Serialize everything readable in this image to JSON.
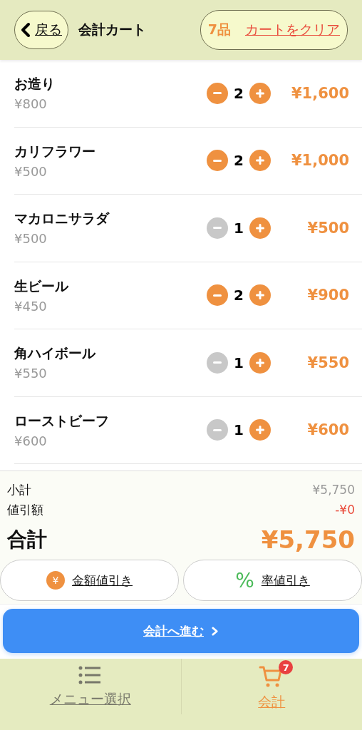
{
  "header": {
    "back_label": "戻る",
    "title": "会計カート",
    "count": "7品",
    "clear_label": "カートをクリア"
  },
  "items": [
    {
      "name": "お造り",
      "unit_price": "¥800",
      "quantity": "2",
      "minus_disabled": false,
      "total": "¥1,600"
    },
    {
      "name": "カリフラワー",
      "unit_price": "¥500",
      "quantity": "2",
      "minus_disabled": false,
      "total": "¥1,000"
    },
    {
      "name": "マカロニサラダ",
      "unit_price": "¥500",
      "quantity": "1",
      "minus_disabled": true,
      "total": "¥500"
    },
    {
      "name": "生ビール",
      "unit_price": "¥450",
      "quantity": "2",
      "minus_disabled": false,
      "total": "¥900"
    },
    {
      "name": "角ハイボール",
      "unit_price": "¥550",
      "quantity": "1",
      "minus_disabled": true,
      "total": "¥550"
    },
    {
      "name": "ローストビーフ",
      "unit_price": "¥600",
      "quantity": "1",
      "minus_disabled": true,
      "total": "¥600"
    }
  ],
  "summary": {
    "subtotal_label": "小計",
    "subtotal": "¥5,750",
    "discount_label": "値引額",
    "discount": "-¥0",
    "total_label": "合計",
    "total": "¥5,750"
  },
  "discount_buttons": [
    {
      "kind": "amount",
      "icon": "¥",
      "label": "金額値引き"
    },
    {
      "kind": "rate",
      "icon": "%",
      "label": "率値引き"
    }
  ],
  "checkout_button": "会計へ進む",
  "tabs": [
    {
      "kind": "menu",
      "label": "メニュー選択",
      "selected": false
    },
    {
      "kind": "cart",
      "label": "会計",
      "selected": true,
      "badge": "7"
    }
  ]
}
